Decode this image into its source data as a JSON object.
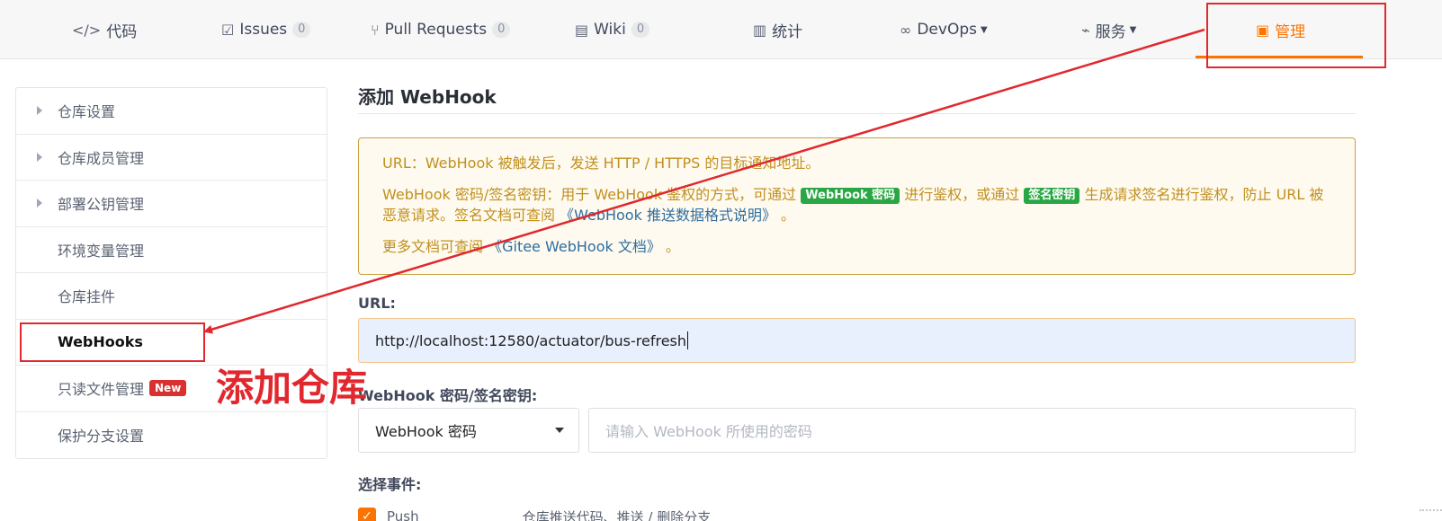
{
  "topnav": {
    "tabs": [
      {
        "icon": "code-icon",
        "glyph": "</>",
        "label": "代码",
        "count": ""
      },
      {
        "icon": "issues-icon",
        "glyph": "☑",
        "label": "Issues",
        "count": "0"
      },
      {
        "icon": "pull-request-icon",
        "glyph": "⑂",
        "label": "Pull Requests",
        "count": "0"
      },
      {
        "icon": "wiki-icon",
        "glyph": "▤",
        "label": "Wiki",
        "count": "0"
      },
      {
        "icon": "stats-icon",
        "glyph": "▥",
        "label": "统计",
        "count": ""
      },
      {
        "icon": "infinity-icon",
        "glyph": "∞",
        "label": "DevOps",
        "count": ""
      },
      {
        "icon": "pulse-icon",
        "glyph": "⌁",
        "label": "服务",
        "count": ""
      },
      {
        "icon": "manage-icon",
        "glyph": "▣",
        "label": "管理",
        "count": ""
      }
    ],
    "accent_color": "#fe7300"
  },
  "sidebar": {
    "items": [
      {
        "label": "仓库设置",
        "expandable": true
      },
      {
        "label": "仓库成员管理",
        "expandable": true
      },
      {
        "label": "部署公钥管理",
        "expandable": true
      },
      {
        "label": "环境变量管理",
        "expandable": false
      },
      {
        "label": "仓库挂件",
        "expandable": false
      },
      {
        "label": "WebHooks",
        "expandable": false,
        "active": true
      },
      {
        "label": "只读文件管理",
        "expandable": false,
        "badge": "New"
      },
      {
        "label": "保护分支设置",
        "expandable": false
      }
    ]
  },
  "main": {
    "title": "添加 WebHook",
    "notice": {
      "line1": "URL：WebHook 被触发后，发送 HTTP / HTTPS 的目标通知地址。",
      "line2_a": "WebHook 密码/签名密钥：用于 WebHook 鉴权的方式，可通过 ",
      "badge_password": "WebHook 密码",
      "line2_b": " 进行鉴权，或通过 ",
      "badge_signature": "签名密钥",
      "line2_c": " 生成请求签名进行鉴权，防止 URL 被恶意请求。签名文档可查阅 ",
      "link_format": "《WebHook 推送数据格式说明》",
      "line2_d": " 。",
      "line3_a": "更多文档可查阅 ",
      "link_docs": "《Gitee WebHook 文档》",
      "line3_b": " 。"
    },
    "url_label": "URL:",
    "url_value": "http://localhost:12580/actuator/bus-refresh",
    "secret_label": "WebHook 密码/签名密钥:",
    "secret_type": "WebHook 密码",
    "secret_placeholder": "请输入 WebHook 所使用的密码",
    "events_label": "选择事件:",
    "event_push_label": "Push",
    "event_push_desc": "仓库推送代码、推送 / 删除分支",
    "event_push_checked": true
  },
  "annotation": {
    "text": "添加仓库",
    "color": "#e0282e"
  }
}
